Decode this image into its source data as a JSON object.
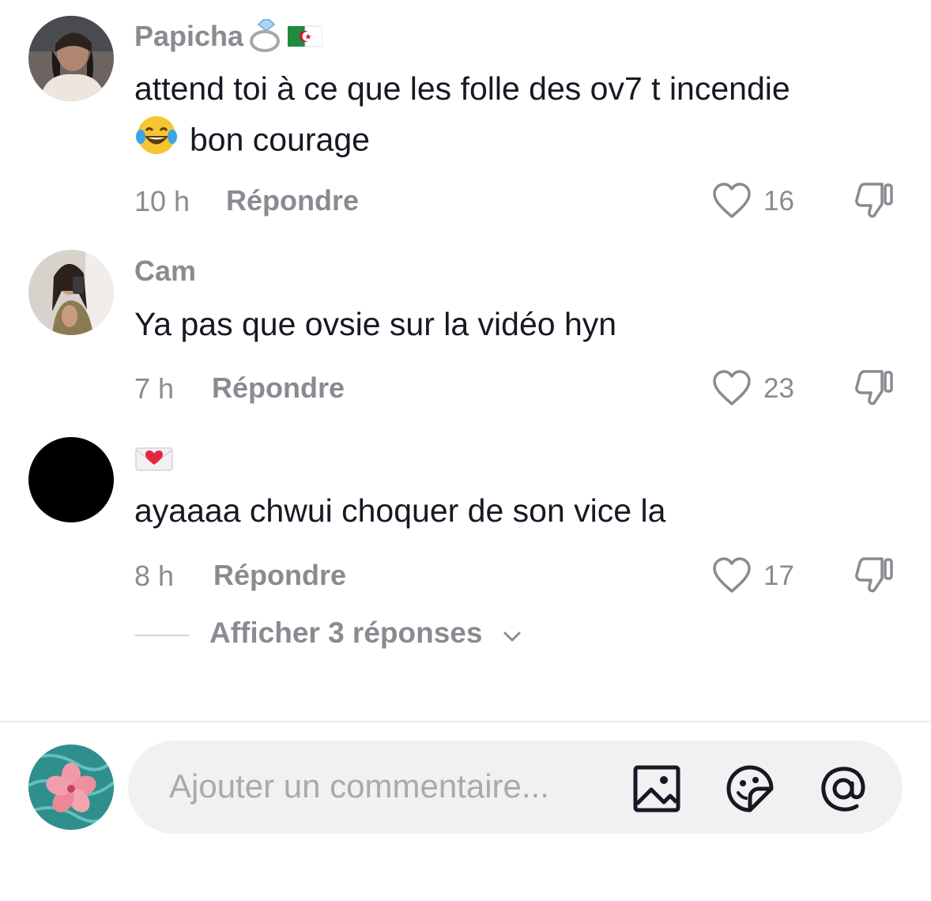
{
  "comments": [
    {
      "username": "Papicha",
      "username_emojis": [
        "ring-icon",
        "algeria-flag-icon"
      ],
      "text_line1": "attend toi à ce que les folle des ov7 t incendie",
      "text_line2_emoji": "laughing-tears-emoji",
      "text_line2": "bon courage",
      "time": "10 h",
      "reply_label": "Répondre",
      "likes": "16"
    },
    {
      "username": "Cam",
      "text": "Ya pas que ovsie sur la vidéo hyn",
      "time": "7 h",
      "reply_label": "Répondre",
      "likes": "23"
    },
    {
      "username_emoji": "love-letter-icon",
      "text": "ayaaaa chwui choquer de son vice la",
      "time": "8 h",
      "reply_label": "Répondre",
      "likes": "17",
      "show_replies_label": "Afficher 3 réponses"
    }
  ],
  "composer": {
    "placeholder": "Ajouter un commentaire...",
    "icons": [
      "image-icon",
      "sticker-emoji-icon",
      "mention-icon"
    ]
  },
  "colors": {
    "text": "#161823",
    "secondary": "#8a8b91",
    "placeholder": "#a9aaae",
    "input_bg": "#f1f1f2"
  }
}
